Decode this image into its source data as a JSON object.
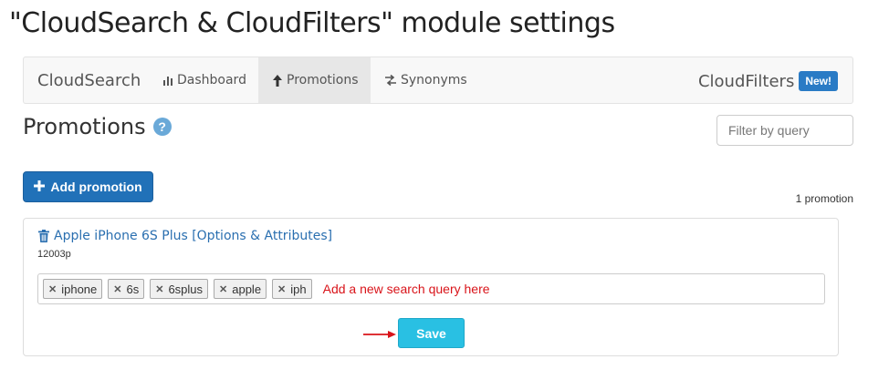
{
  "page": {
    "title": "\"CloudSearch & CloudFilters\" module settings"
  },
  "navbar": {
    "brand": "CloudSearch",
    "items": [
      {
        "label": "Dashboard",
        "icon": "bar-chart-icon"
      },
      {
        "label": "Promotions",
        "icon": "arrow-up-icon",
        "active": true
      },
      {
        "label": "Synonyms",
        "icon": "swap-icon"
      }
    ],
    "right_label": "CloudFilters",
    "badge": "New!"
  },
  "section": {
    "title": "Promotions"
  },
  "filter": {
    "placeholder": "Filter by query"
  },
  "add_button": {
    "label": "Add promotion"
  },
  "promo_count": "1 promotion",
  "promotion": {
    "title": "Apple iPhone 6S Plus [Options & Attributes]",
    "sku": "12003p",
    "tags": [
      "iphone",
      "6s",
      "6splus",
      "apple",
      "iph"
    ],
    "input_hint": "Add a new search query here"
  },
  "save_button": {
    "label": "Save"
  },
  "colors": {
    "primary": "#2171b8",
    "save": "#29c0e3",
    "hint": "#d9141a",
    "badge": "#2a7bc5"
  }
}
